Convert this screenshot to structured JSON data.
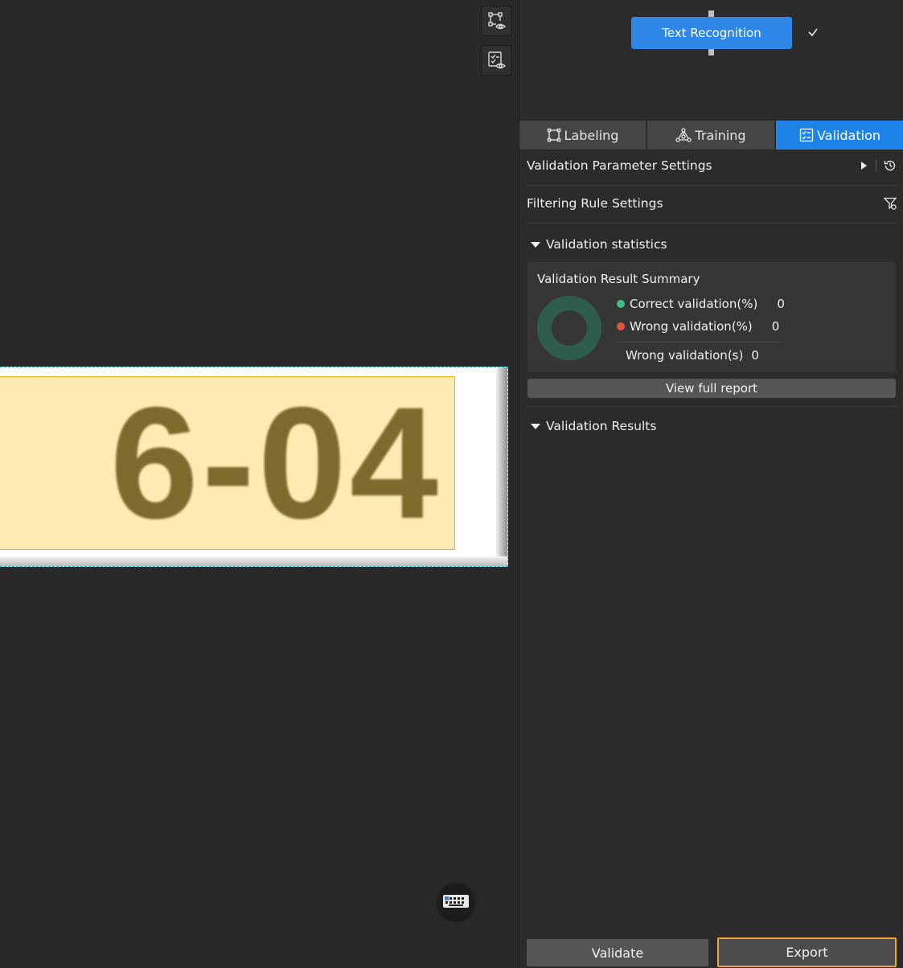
{
  "canvas": {
    "image_text": "6-04",
    "tools": {
      "label_view_icon": "bounding-box-eye-icon",
      "result_view_icon": "checklist-eye-icon"
    },
    "keyboard_icon": "keyboard-icon"
  },
  "panel": {
    "model_node": {
      "label": "Text Recognition",
      "status_icon": "check-icon"
    },
    "tabs": [
      {
        "label": "Labeling",
        "icon": "bounding-box-icon",
        "active": false
      },
      {
        "label": "Training",
        "icon": "network-icon",
        "active": false
      },
      {
        "label": "Validation",
        "icon": "checklist-icon",
        "active": true
      }
    ],
    "validation_params": {
      "label": "Validation Parameter Settings"
    },
    "filter_rules": {
      "label": "Filtering Rule Settings"
    },
    "statistics": {
      "heading": "Validation statistics",
      "summary_title": "Validation Result Summary",
      "correct": {
        "label": "Correct validation(%)",
        "value": "0",
        "color": "#3fbf84"
      },
      "wrong": {
        "label": "Wrong validation(%)",
        "value": "0",
        "color": "#e0533c"
      },
      "wrong_count": {
        "label": "Wrong validation(s)",
        "value": "0"
      },
      "donut_color": "#2f5d4b",
      "view_report": "View full report"
    },
    "results": {
      "heading": "Validation Results"
    },
    "actions": {
      "validate": "Validate",
      "export": "Export"
    }
  },
  "colors": {
    "accent": "#1e83e6",
    "export_border": "#f2a33a",
    "label_fill": "#ffeab4",
    "label_border": "#e7b913"
  }
}
